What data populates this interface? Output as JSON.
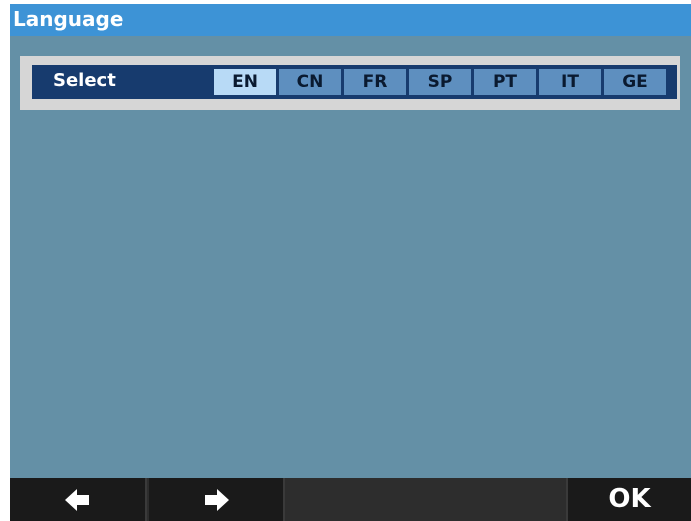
{
  "window": {
    "title": "Language"
  },
  "language_panel": {
    "select_label": "Select",
    "options": [
      "EN",
      "CN",
      "FR",
      "SP",
      "PT",
      "IT",
      "GE"
    ],
    "selected": "EN"
  },
  "bottom_bar": {
    "prev_icon": "arrow-left-icon",
    "next_icon": "arrow-right-icon",
    "ok_label": "OK"
  },
  "colors": {
    "background": "#6490a6",
    "title_bar": "#3d93d6",
    "select_row": "#173b6e",
    "option": "#5e8fbf",
    "option_selected": "#b8daf6",
    "bottom_bar": "#1a1a1a"
  }
}
